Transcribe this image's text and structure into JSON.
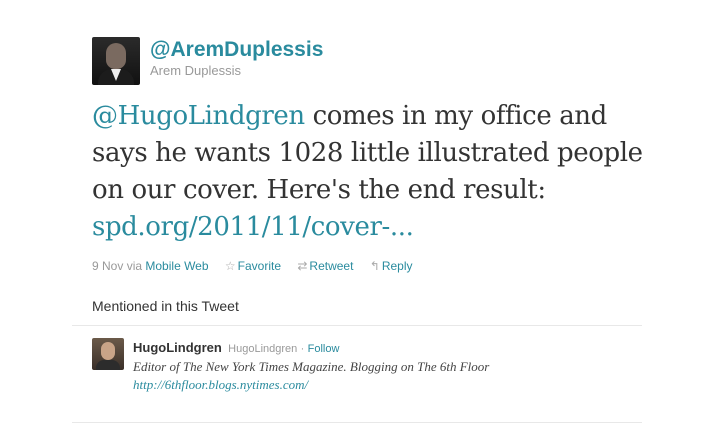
{
  "author": {
    "screen_name": "@AremDuplessis",
    "full_name": "Arem Duplessis"
  },
  "tweet": {
    "mention": "@HugoLindgren",
    "text_rest": " comes in my office and says he wants 1028 little illustrated people on our cover. Here's the end result: ",
    "link": "spd.org/2011/11/cover-..."
  },
  "meta": {
    "date": "9 Nov",
    "via_label": "via",
    "client": "Mobile Web",
    "favorite_label": "Favorite",
    "retweet_label": "Retweet",
    "reply_label": "Reply"
  },
  "mentioned": {
    "heading": "Mentioned in this Tweet",
    "users": [
      {
        "name": "HugoLindgren",
        "handle": "HugoLindgren",
        "separator": "·",
        "follow_label": "Follow",
        "bio_text": "Editor of The New York Times Magazine. Blogging on The 6th Floor ",
        "bio_link": "http://6thfloor.blogs.nytimes.com/"
      }
    ]
  },
  "icons": {
    "favorite": "star-icon",
    "retweet": "retweet-icon",
    "reply": "reply-icon"
  },
  "colors": {
    "link": "#2a8b9e",
    "muted": "#999999",
    "text": "#333333"
  }
}
